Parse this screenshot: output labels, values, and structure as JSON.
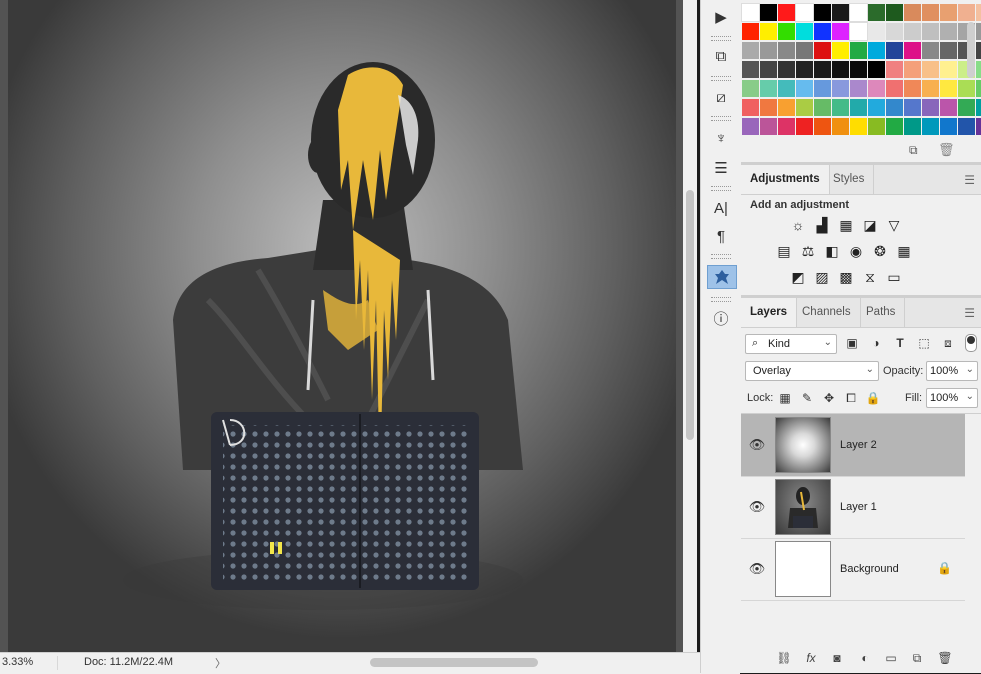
{
  "status_bar": {
    "zoom": "3.33%",
    "doc_size": "Doc: 11.2M/22.4M",
    "arrow": "〉"
  },
  "tools": [
    {
      "name": "play-icon",
      "glyph": "▶"
    },
    {
      "name": "3d-icon",
      "glyph": "⧉"
    },
    {
      "name": "transform-icon",
      "glyph": "⧄"
    },
    {
      "name": "brushes-icon",
      "glyph": "♆"
    },
    {
      "name": "properties-icon",
      "glyph": "☰"
    },
    {
      "name": "character-icon",
      "glyph": "A|"
    },
    {
      "name": "paragraph-icon",
      "glyph": "¶"
    },
    {
      "name": "info-icon",
      "glyph": "ⓘ"
    }
  ],
  "swatches": {
    "rows": [
      [
        "#ffffff",
        "#000000",
        "#ff1a1a",
        "#ffffff",
        "#000000",
        "#1a1a1a",
        "#ffffff",
        "#2b6b2b",
        "#1e5a1e",
        "#d98a5c",
        "#e09060",
        "#e8a070",
        "#f0b090",
        "#f4c0a0"
      ],
      [
        "#ff2200",
        "#ffee00",
        "#33dd00",
        "#00dddd",
        "#1133ff",
        "#dd22ff",
        "#ffffff",
        "#e8e8e8",
        "#d8d8d8",
        "#cccccc",
        "#bfbfbf",
        "#b0b0b0",
        "#a5a5a5",
        "#999999"
      ],
      [
        "#aaaaaa",
        "#999999",
        "#888888",
        "#777777",
        "#dd1111",
        "#ffee00",
        "#22aa44",
        "#00aadd",
        "#224499",
        "#dd1188",
        "#888888",
        "#666666",
        "#555555",
        "#444444"
      ],
      [
        "#555555",
        "#444444",
        "#333333",
        "#222222",
        "#1a1a1a",
        "#111111",
        "#0a0a0a",
        "#000000",
        "#f08080",
        "#f4a07a",
        "#f8c088",
        "#fff090",
        "#ccee88",
        "#88dd88"
      ],
      [
        "#88cc88",
        "#66ccaa",
        "#44bbbb",
        "#66bbee",
        "#6699dd",
        "#8899dd",
        "#aa88cc",
        "#dd88bb",
        "#f07070",
        "#f08858",
        "#f8b050",
        "#ffe840",
        "#aadd55",
        "#66cc66"
      ],
      [
        "#f06060",
        "#f07840",
        "#f8a030",
        "#aacc44",
        "#66bb66",
        "#44bb88",
        "#22aaaa",
        "#22aadd",
        "#3388cc",
        "#5577cc",
        "#8866bb",
        "#bb55aa",
        "#33aa55",
        "#00a0a0"
      ],
      [
        "#9966bb",
        "#bb5599",
        "#dd3366",
        "#ee2222",
        "#ee5511",
        "#f09010",
        "#ffdd00",
        "#88bb22",
        "#22aa44",
        "#009988",
        "#0099bb",
        "#1177cc",
        "#2255aa",
        "#663399"
      ]
    ],
    "new_icon": "new-swatch-icon",
    "delete_icon": "trash-icon"
  },
  "adjustments": {
    "tabs": [
      "Adjustments",
      "Styles"
    ],
    "heading": "Add an adjustment",
    "icons": [
      {
        "name": "brightness-icon",
        "glyph": "☼"
      },
      {
        "name": "levels-icon",
        "glyph": "▟"
      },
      {
        "name": "curves-icon",
        "glyph": "▦"
      },
      {
        "name": "exposure-icon",
        "glyph": "◪"
      },
      {
        "name": "vibrance-icon",
        "glyph": "▽"
      },
      {
        "name": "hue-saturation-icon",
        "glyph": "▤"
      },
      {
        "name": "color-balance-icon",
        "glyph": "⚖"
      },
      {
        "name": "black-white-icon",
        "glyph": "◧"
      },
      {
        "name": "photo-filter-icon",
        "glyph": "◉"
      },
      {
        "name": "channel-mixer-icon",
        "glyph": "❂"
      },
      {
        "name": "color-lookup-icon",
        "glyph": "▦"
      },
      {
        "name": "invert-icon",
        "glyph": "◩"
      },
      {
        "name": "posterize-icon",
        "glyph": "▨"
      },
      {
        "name": "threshold-icon",
        "glyph": "▩"
      },
      {
        "name": "selective-color-icon",
        "glyph": "⧖"
      },
      {
        "name": "gradient-map-icon",
        "glyph": "▭"
      }
    ]
  },
  "layers": {
    "tabs": [
      "Layers",
      "Channels",
      "Paths"
    ],
    "kind_label": "Kind",
    "blend_mode": "Overlay",
    "opacity_label": "Opacity:",
    "opacity": "100%",
    "lock_label": "Lock:",
    "fill_label": "Fill:",
    "fill": "100%",
    "items": [
      {
        "name": "Layer 2",
        "selected": true
      },
      {
        "name": "Layer 1",
        "selected": false
      },
      {
        "name": "Background",
        "selected": false,
        "locked": true
      }
    ]
  }
}
